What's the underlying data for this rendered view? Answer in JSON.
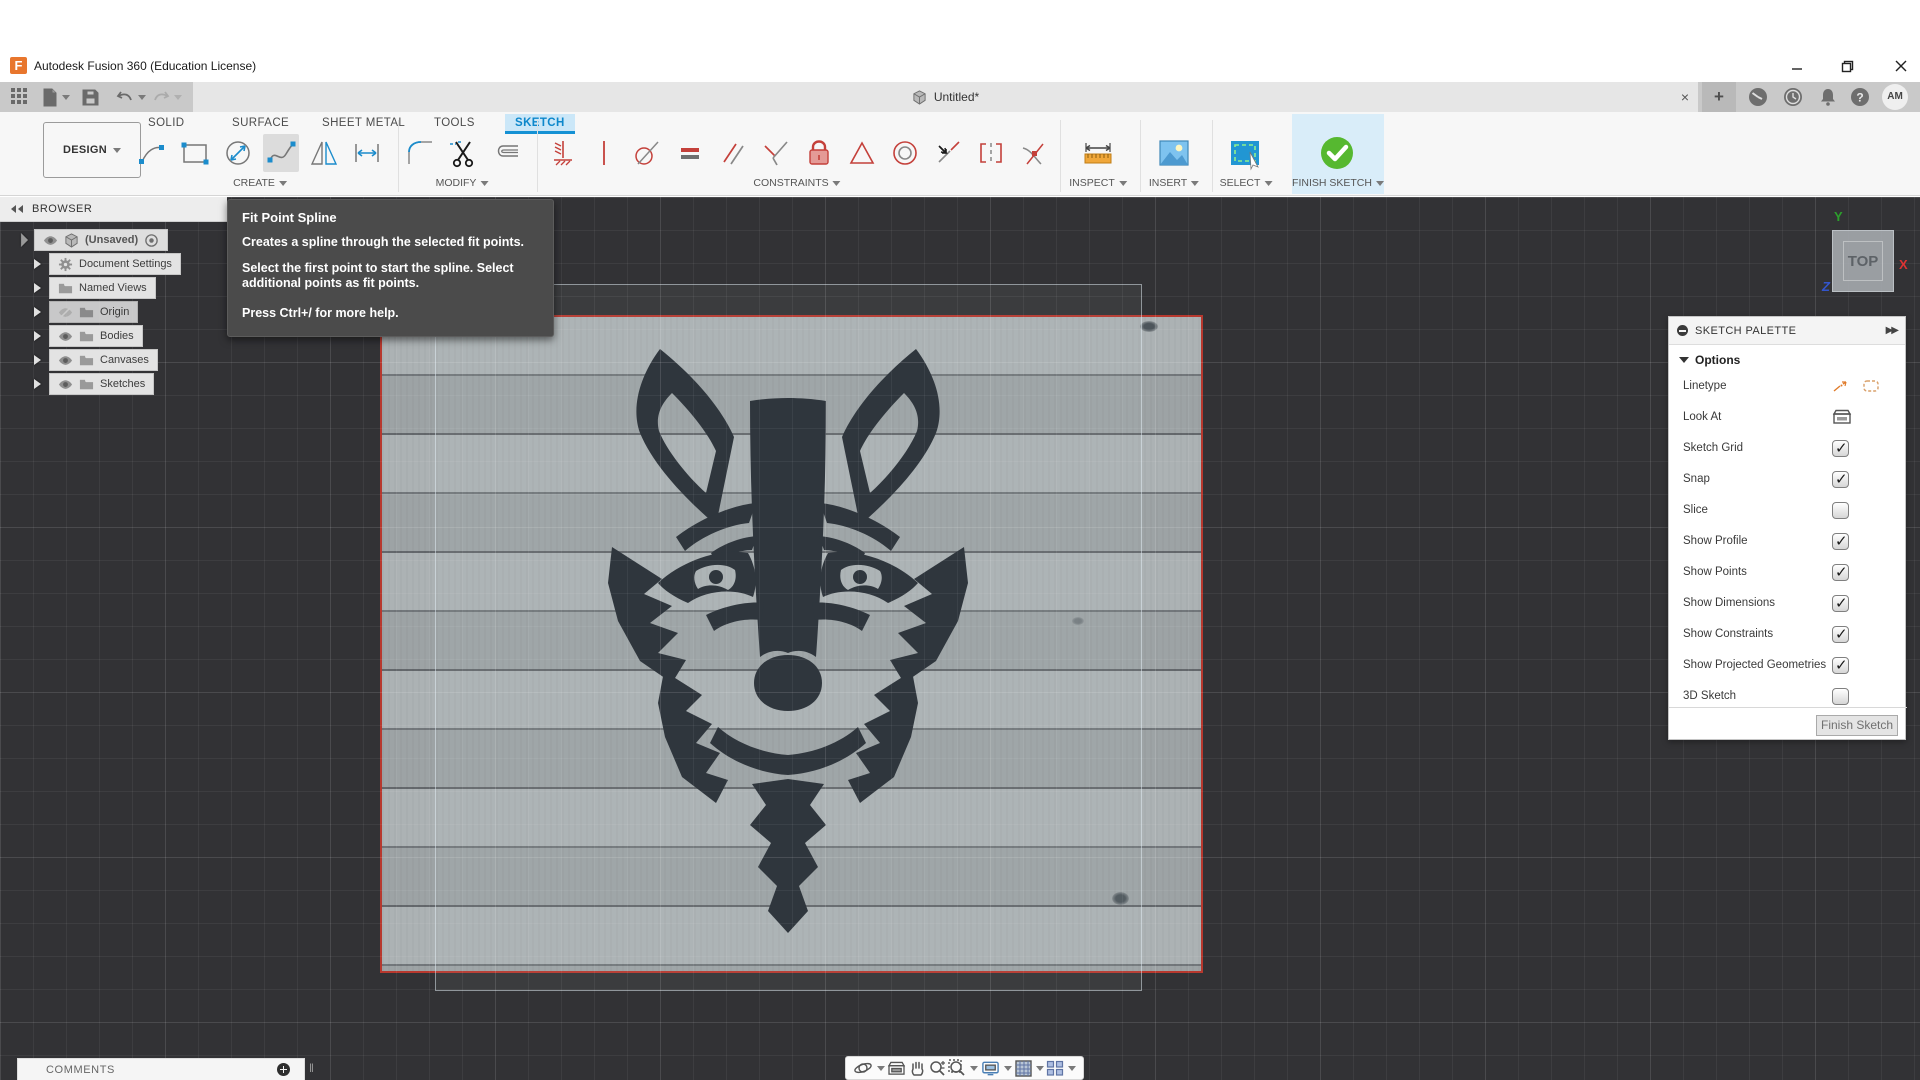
{
  "window": {
    "title": "Autodesk Fusion 360 (Education License)",
    "controls": [
      "minimize",
      "restore",
      "close"
    ]
  },
  "tabbar": {
    "document_tab": "Untitled*",
    "close_tab_glyph": "×",
    "new_tab_glyph": "+",
    "help_glyph": "?",
    "user_initials": "AM",
    "quick_access_icons": [
      "app-launcher-icon",
      "file-new-icon",
      "save-icon",
      "undo-icon",
      "redo-icon"
    ],
    "right_icons": [
      "job-status-icon",
      "recent-icon",
      "notifications-bell-icon",
      "help-icon",
      "account-avatar"
    ]
  },
  "ribbon": {
    "workspace_button": "DESIGN",
    "tabs": [
      {
        "label": "SOLID",
        "active": false
      },
      {
        "label": "SURFACE",
        "active": false
      },
      {
        "label": "SHEET METAL",
        "active": false
      },
      {
        "label": "TOOLS",
        "active": false
      },
      {
        "label": "SKETCH",
        "active": true
      }
    ],
    "groups": [
      {
        "label": "CREATE"
      },
      {
        "label": "MODIFY"
      },
      {
        "label": "CONSTRAINTS"
      },
      {
        "label": "INSPECT"
      },
      {
        "label": "INSERT"
      },
      {
        "label": "SELECT"
      },
      {
        "label": "FINISH SKETCH"
      }
    ],
    "create_icons": [
      "line-icon",
      "rectangle-icon",
      "circle-icon",
      "spline-icon",
      "mirror-icon",
      "sketch-dimension-icon"
    ],
    "selected_tool": "spline-icon",
    "modify_icons": [
      "fillet-icon",
      "trim-scissors-icon",
      "offset-icon"
    ],
    "constraint_icons": [
      "coincident-icon",
      "vertical-horizontal-icon",
      "tangent-icon",
      "equal-icon",
      "parallel-icon",
      "perpendicular-icon",
      "fix-lock-icon",
      "collinear-icon",
      "concentric-icon",
      "midpoint-icon",
      "symmetry-icon",
      "curvature-icon"
    ],
    "inspect_icons": [
      "measure-icon"
    ],
    "insert_icons": [
      "insert-image-icon"
    ],
    "select_icons": [
      "select-icon"
    ],
    "finish_icons": [
      "finish-sketch-check-icon"
    ]
  },
  "browser": {
    "header": "BROWSER",
    "items": [
      {
        "label": "(Unsaved)"
      },
      {
        "label": "Document Settings"
      },
      {
        "label": "Named Views"
      },
      {
        "label": "Origin",
        "hidden": true
      },
      {
        "label": "Bodies"
      },
      {
        "label": "Canvases"
      },
      {
        "label": "Sketches"
      }
    ]
  },
  "tooltip": {
    "title": "Fit Point Spline",
    "line1": "Creates a spline through the selected fit points.",
    "line2": "Select the first point to start the spline. Select additional points as fit points.",
    "line3": "Press Ctrl+/ for more help."
  },
  "viewcube": {
    "face": "TOP",
    "axis_x": "X",
    "axis_y": "Y",
    "axis_z": "Z"
  },
  "palette": {
    "header": "SKETCH PALETTE",
    "section": "Options",
    "rows": [
      {
        "label": "Linetype",
        "type": "icons"
      },
      {
        "label": "Look At",
        "type": "icon"
      },
      {
        "label": "Sketch Grid",
        "checked": true
      },
      {
        "label": "Snap",
        "checked": true
      },
      {
        "label": "Slice",
        "checked": false
      },
      {
        "label": "Show Profile",
        "checked": true
      },
      {
        "label": "Show Points",
        "checked": true
      },
      {
        "label": "Show Dimensions",
        "checked": true
      },
      {
        "label": "Show Constraints",
        "checked": true
      },
      {
        "label": "Show Projected Geometries",
        "checked": true
      },
      {
        "label": "3D Sketch",
        "checked": false
      }
    ],
    "finish_button": "Finish Sketch"
  },
  "navbar_icons": [
    "orbit-icon",
    "look-at-icon",
    "pan-hand-icon",
    "zoom-icon",
    "zoom-window-icon",
    "display-settings-icon",
    "grid-layout-icon",
    "viewports-icon"
  ],
  "comments": {
    "label": "COMMENTS"
  },
  "colors": {
    "accent_blue": "#1591d4",
    "constraint_red": "#c4403a",
    "finish_green": "#56b830",
    "canvas_border_red": "#b7382e",
    "viewport_bg": "#323235",
    "measure_orange": "#e8960c"
  }
}
